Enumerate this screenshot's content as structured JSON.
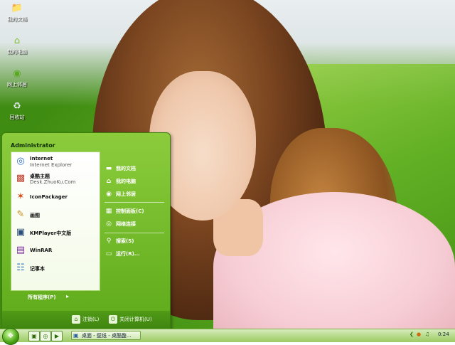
{
  "desktop": {
    "icons": [
      {
        "label": "我的文档",
        "icon": "folder-icon"
      },
      {
        "label": "我的电脑",
        "icon": "computer-icon"
      },
      {
        "label": "网上邻居",
        "icon": "network-icon"
      },
      {
        "label": "回收站",
        "icon": "recycle-bin-icon"
      }
    ]
  },
  "start_menu": {
    "user": "Administrator",
    "pinned": [
      {
        "title": "Internet",
        "subtitle": "Internet Explorer",
        "icon": "internet-explorer-icon"
      },
      {
        "title": "桌酷主题",
        "subtitle": "Desk.ZhuoKu.Com",
        "icon": "zhuoku-theme-icon"
      }
    ],
    "recent": [
      {
        "title": "IconPackager",
        "icon": "iconpackager-icon"
      },
      {
        "title": "画图",
        "icon": "paint-icon"
      },
      {
        "title": "KMPlayer中文版",
        "icon": "kmplayer-icon"
      },
      {
        "title": "WinRAR",
        "icon": "winrar-icon"
      },
      {
        "title": "记事本",
        "icon": "notepad-icon"
      }
    ],
    "all_programs": "所有程序(P)",
    "right_items": [
      {
        "label": "我的文档",
        "icon": "folder-icon"
      },
      {
        "label": "我的电脑",
        "icon": "computer-icon"
      },
      {
        "label": "网上邻居",
        "icon": "network-icon"
      },
      {
        "label": "控制面板(C)",
        "icon": "control-panel-icon"
      },
      {
        "label": "网络连接",
        "icon": "network-connections-icon"
      },
      {
        "label": "搜索(S)",
        "icon": "search-icon"
      },
      {
        "label": "运行(R)...",
        "icon": "run-icon"
      }
    ],
    "logoff": "注销(L)",
    "shutdown": "关闭计算机(U)"
  },
  "taskbar": {
    "task_label": "桌面 - 壁纸 - 桌酷整...",
    "clock": "0:24"
  }
}
